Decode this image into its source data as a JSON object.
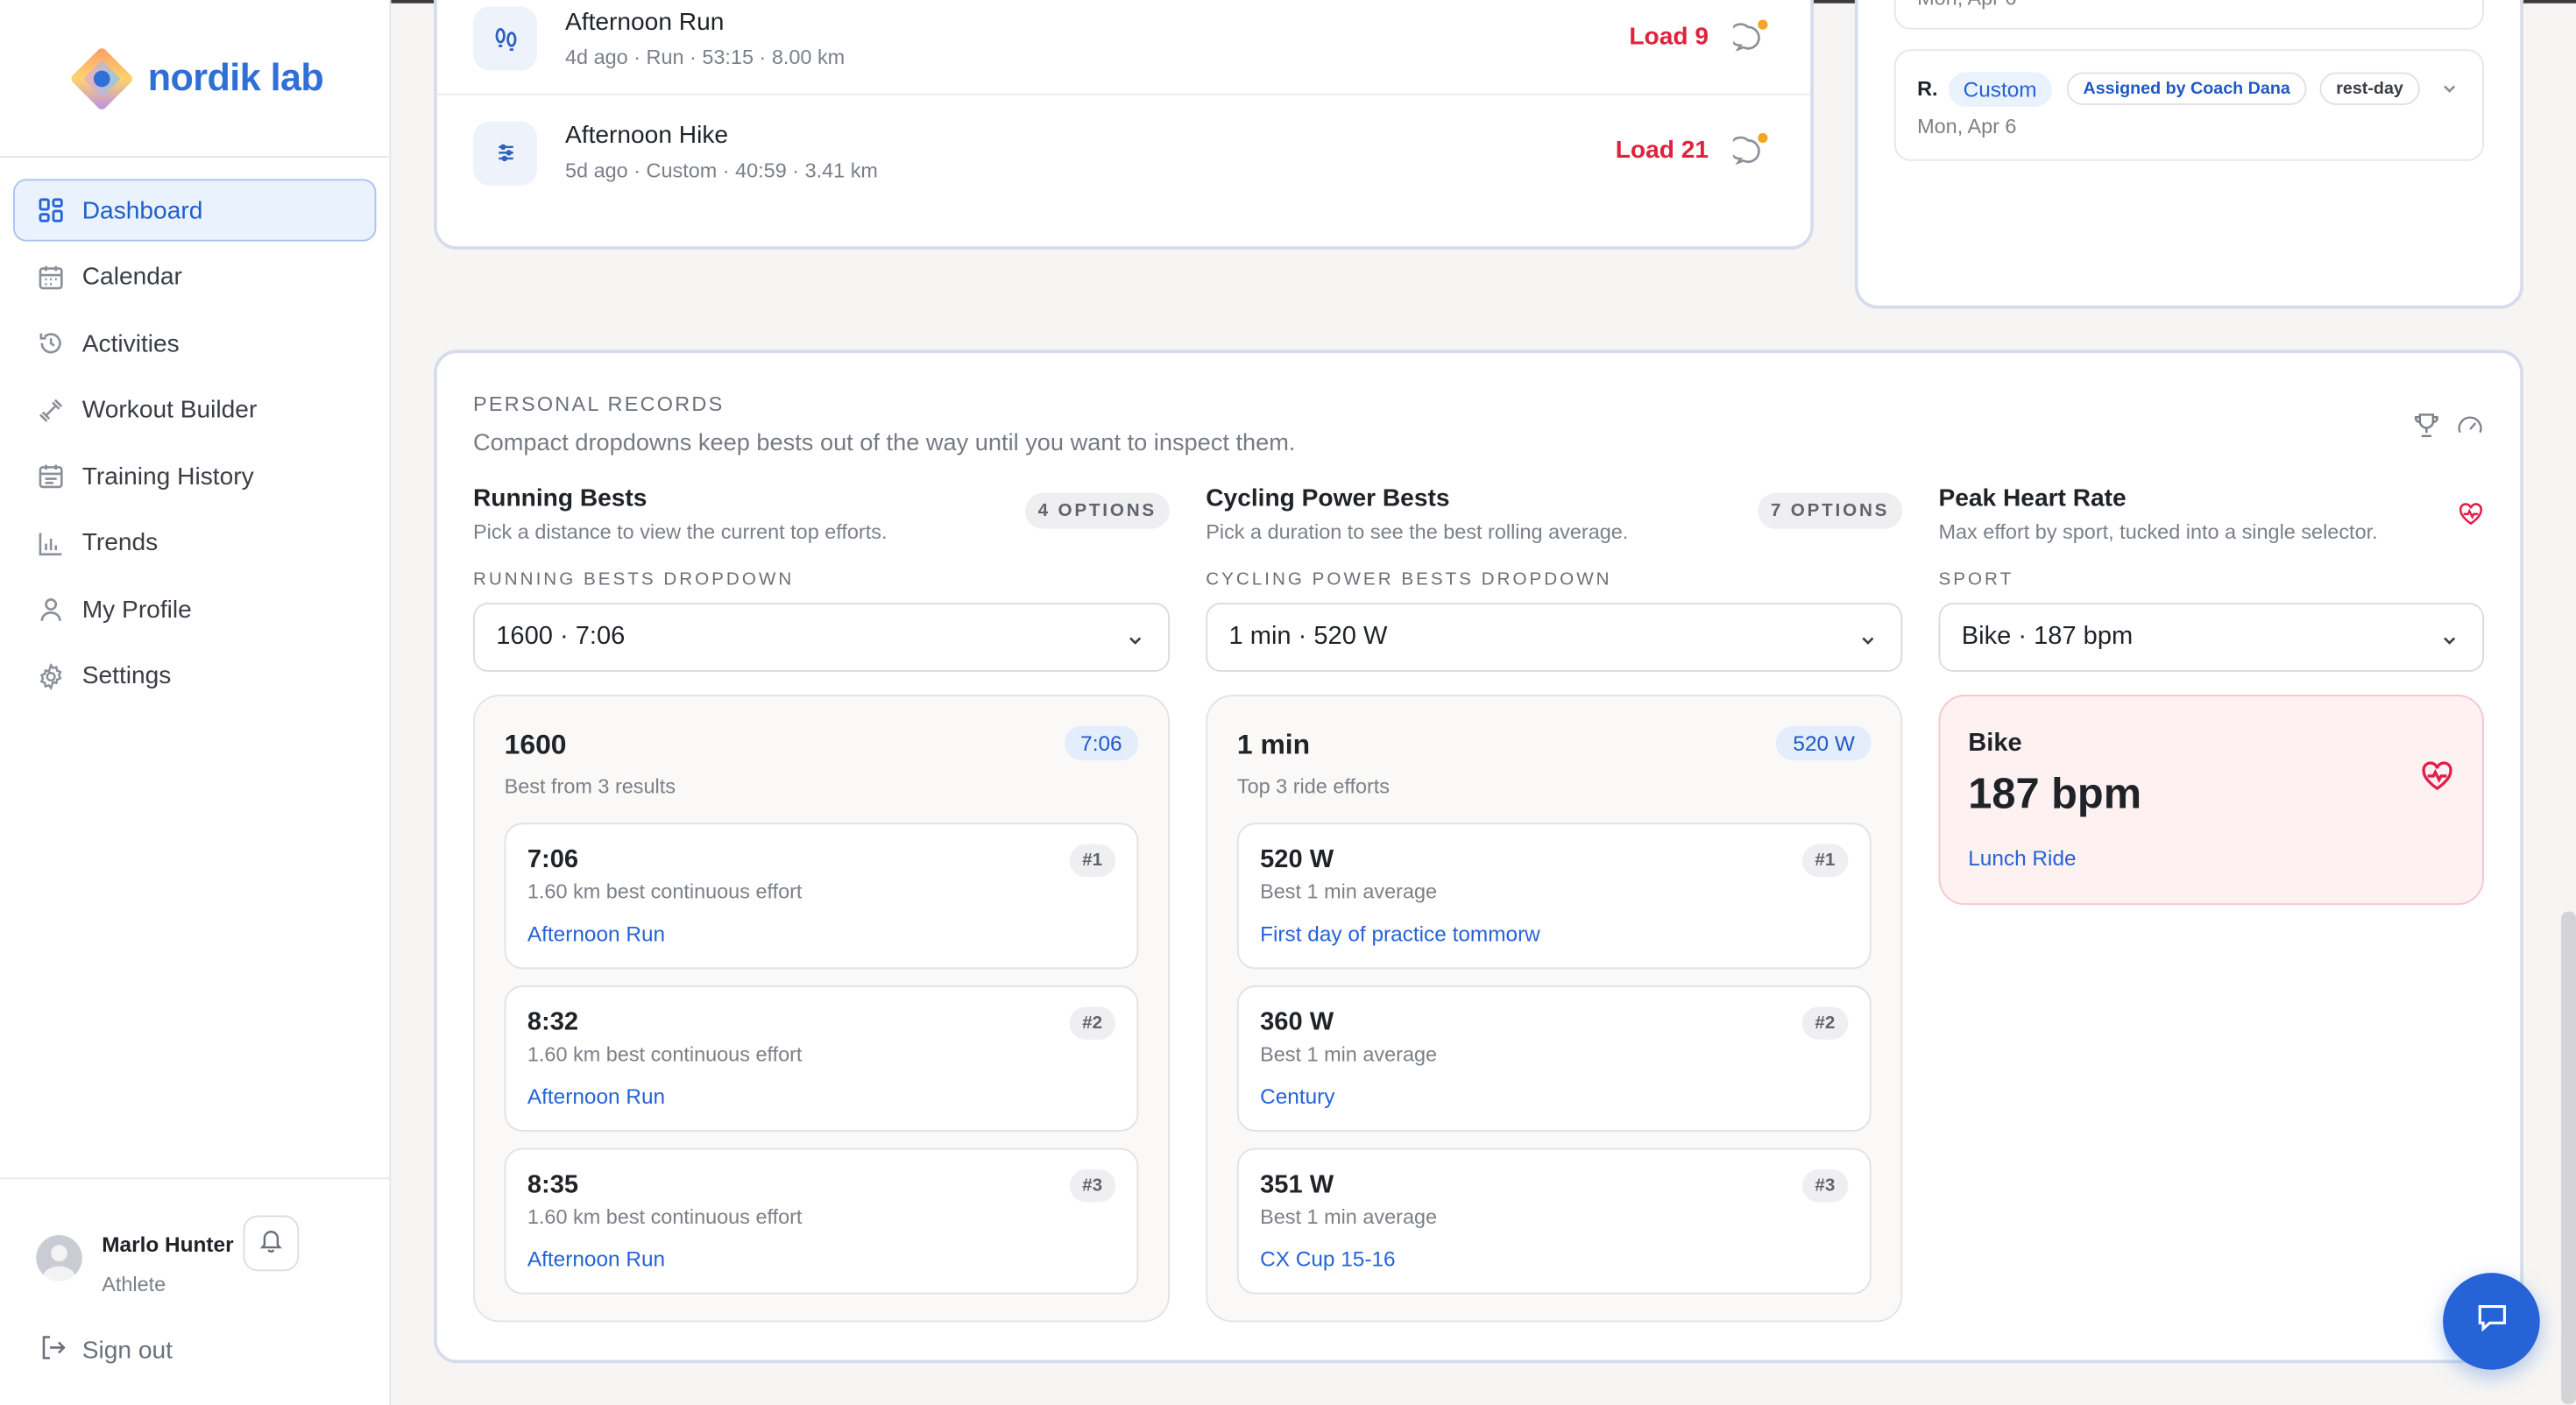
{
  "brand": {
    "name": "nordik lab"
  },
  "nav": {
    "items": [
      {
        "label": "Dashboard",
        "icon": "grid-icon"
      },
      {
        "label": "Calendar",
        "icon": "calendar-icon"
      },
      {
        "label": "Activities",
        "icon": "history-icon"
      },
      {
        "label": "Workout Builder",
        "icon": "dumbbell-icon"
      },
      {
        "label": "Training History",
        "icon": "calendar-list-icon"
      },
      {
        "label": "Trends",
        "icon": "bar-chart-icon"
      },
      {
        "label": "My Profile",
        "icon": "user-icon"
      },
      {
        "label": "Settings",
        "icon": "gear-icon"
      }
    ],
    "active": "Dashboard"
  },
  "user": {
    "name": "Marlo Hunter",
    "role": "Athlete",
    "sign_out": "Sign out"
  },
  "activities": [
    {
      "title": "Afternoon Run",
      "meta": "4d ago · Run · 53:15 · 8.00 km",
      "load": "Load 9",
      "icon": "footprints-icon"
    },
    {
      "title": "Afternoon Hike",
      "meta": "5d ago · Custom · 40:59 · 3.41 km",
      "load": "Load 21",
      "icon": "sliders-icon"
    }
  ],
  "assignments": [
    {
      "date": "Mon, Apr 6"
    },
    {
      "initial": "R.",
      "type": "Custom",
      "assigned": "Assigned by Coach Dana",
      "tag": "rest-day",
      "date": "Mon, Apr 6"
    }
  ],
  "records": {
    "title": "PERSONAL RECORDS",
    "subtitle": "Compact dropdowns keep bests out of the way until you want to inspect them.",
    "running": {
      "title": "Running Bests",
      "subtitle": "Pick a distance to view the current top efforts.",
      "options": "4 OPTIONS",
      "dropdown_label": "RUNNING BESTS DROPDOWN",
      "selected": "1600 · 7:06",
      "panel_title": "1600",
      "panel_badge": "7:06",
      "panel_sub": "Best from 3 results",
      "results": [
        {
          "value": "7:06",
          "desc": "1.60 km best continuous effort",
          "link": "Afternoon Run",
          "rank": "#1"
        },
        {
          "value": "8:32",
          "desc": "1.60 km best continuous effort",
          "link": "Afternoon Run",
          "rank": "#2"
        },
        {
          "value": "8:35",
          "desc": "1.60 km best continuous effort",
          "link": "Afternoon Run",
          "rank": "#3"
        }
      ]
    },
    "cycling": {
      "title": "Cycling Power Bests",
      "subtitle": "Pick a duration to see the best rolling average.",
      "options": "7 OPTIONS",
      "dropdown_label": "CYCLING POWER BESTS DROPDOWN",
      "selected": "1 min · 520 W",
      "panel_title": "1 min",
      "panel_badge": "520 W",
      "panel_sub": "Top 3 ride efforts",
      "results": [
        {
          "value": "520 W",
          "desc": "Best 1 min average",
          "link": "First day of practice tommorw",
          "rank": "#1"
        },
        {
          "value": "360 W",
          "desc": "Best 1 min average",
          "link": "Century",
          "rank": "#2"
        },
        {
          "value": "351 W",
          "desc": "Best 1 min average",
          "link": "CX Cup 15-16",
          "rank": "#3"
        }
      ]
    },
    "heart": {
      "title": "Peak Heart Rate",
      "subtitle": "Max effort by sport, tucked into a single selector.",
      "dropdown_label": "SPORT",
      "selected": "Bike · 187 bpm",
      "sport": "Bike",
      "value": "187 bpm",
      "link": "Lunch Ride"
    }
  },
  "colors": {
    "accent": "#2563d6",
    "load": "#e0233d",
    "heart": "#e11d48"
  }
}
